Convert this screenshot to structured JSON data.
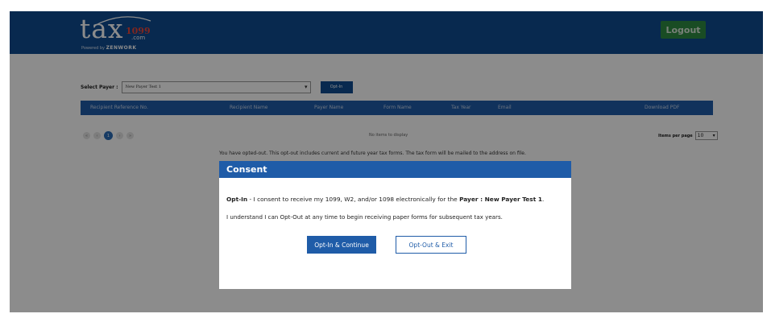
{
  "header": {
    "logo": {
      "main": "tax",
      "superscript": "1099",
      "domain": ".com",
      "powered_prefix": "Powered by",
      "powered_brand": "ZENWORK"
    },
    "logout_label": "Logout"
  },
  "filter": {
    "label": "Select Payer :",
    "selected_payer": "New Payer Test 1",
    "optin_button": "Opt-In"
  },
  "grid": {
    "columns": [
      "Recipient Reference No.",
      "Recipient Name",
      "Payer Name",
      "Form Name",
      "Tax Year",
      "Email",
      "Download PDF"
    ],
    "empty_message": "No items to display"
  },
  "pager": {
    "buttons": [
      "«",
      "‹",
      "1",
      "›",
      "»"
    ],
    "current_page": "1",
    "items_per_page_label": "Items per page",
    "items_per_page_value": "10"
  },
  "optout_message": "You have opted-out. This opt-out includes current and future year tax forms. The tax form will be mailed to the address on file.",
  "modal": {
    "title": "Consent",
    "line1_bold_prefix": "Opt-In",
    "line1_text": " - I consent to receive my 1099, W2, and/or 1098 electronically for the ",
    "line1_bold_suffix": "Payer : New Payer Test 1",
    "line1_end": ".",
    "line2": "I understand I can Opt-Out at any time to begin receiving paper forms for subsequent tax years.",
    "continue_button": "Opt-In & Continue",
    "exit_button": "Opt-Out & Exit"
  },
  "colors": {
    "header_bg": "#0f4c91",
    "logout_bg": "#2f8a43",
    "primary": "#1f5ca8"
  }
}
